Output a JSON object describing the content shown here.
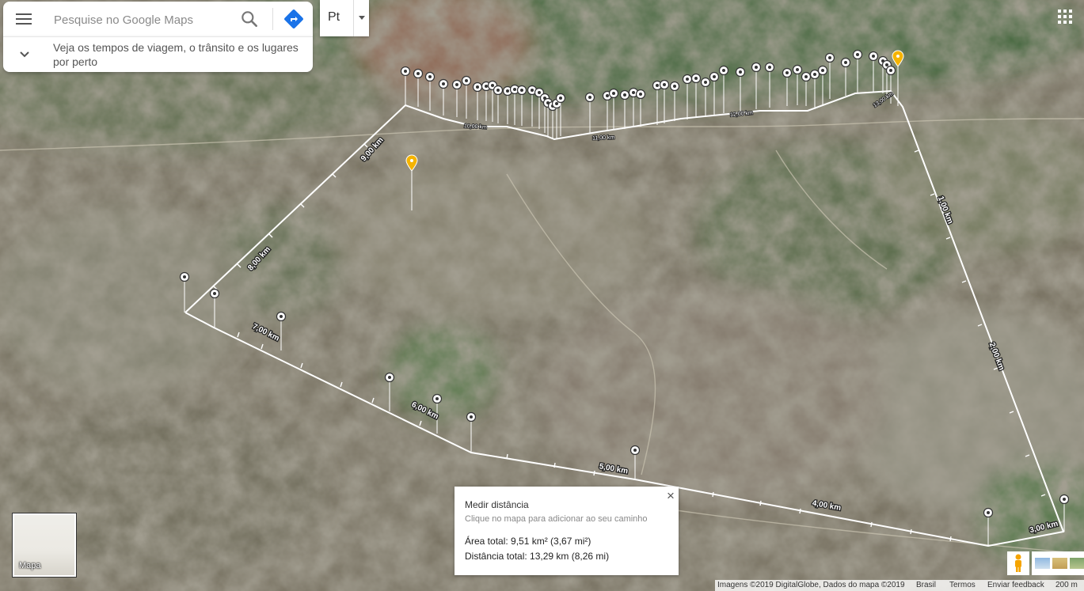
{
  "search": {
    "placeholder": "Pesquise no Google Maps"
  },
  "icons": {
    "menu": "menu-icon",
    "search": "search-icon",
    "directions": "directions-icon",
    "expand": "chevron-down-icon",
    "apps": "apps-grid-icon",
    "pegman": "pegman-icon",
    "close": "close-icon"
  },
  "colors": {
    "directions_blue": "#1a73e8",
    "pin_yellow": "#f5b400",
    "path_white": "#ffffff"
  },
  "subpanel": {
    "text": "Veja os tempos de viagem, o trânsito e os lugares por perto"
  },
  "language": {
    "label": "Pt"
  },
  "map": {
    "distance_labels": [
      "9,00 km",
      "8,00 km",
      "7,00 km",
      "6,00 km",
      "5,00 km",
      "4,00 km",
      "3,00 km",
      "2,00 km",
      "1,00 km"
    ],
    "small_labels": [
      "10,00 km",
      "11,00 km",
      "12,00 km",
      "13,00 km"
    ]
  },
  "measure": {
    "title": "Medir distância",
    "hint": "Clique no mapa para adicionar ao seu caminho",
    "area": "Área total: 9,51 km² (3,67 mi²)",
    "distance": "Distância total: 13,29 km (8,26 mi)",
    "close": "×"
  },
  "layer": {
    "label": "Mapa"
  },
  "footer": {
    "imagery": "Imagens ©2019 DigitalGlobe, Dados do mapa ©2019",
    "country": "Brasil",
    "terms": "Termos",
    "feedback": "Enviar feedback",
    "scale": "200 m"
  }
}
